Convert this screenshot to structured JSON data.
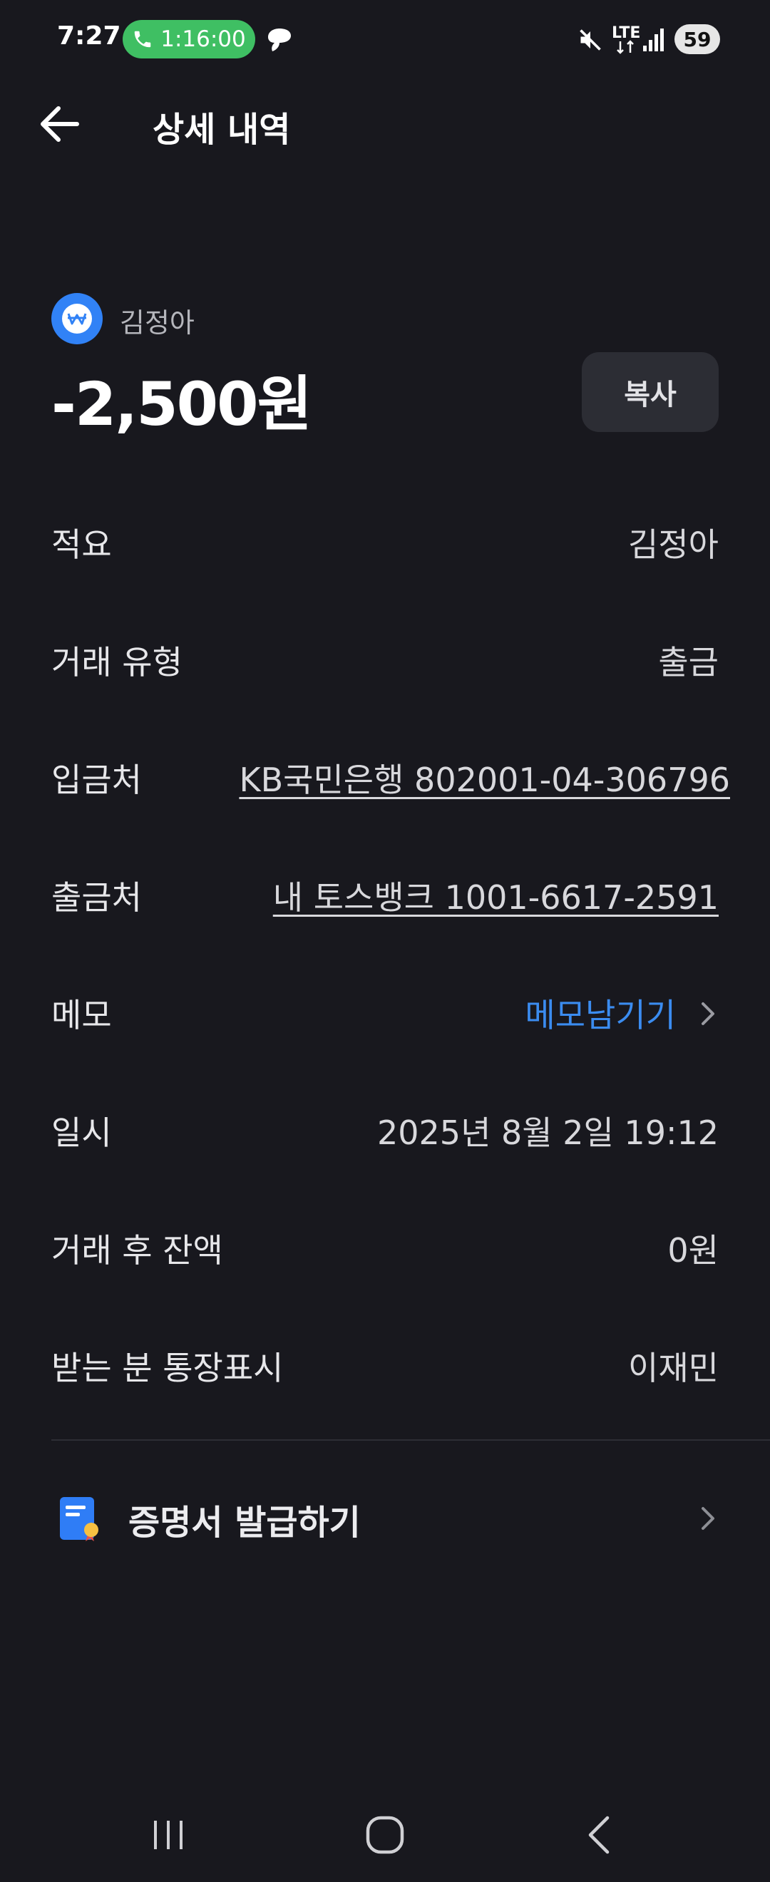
{
  "status_bar": {
    "time": "7:27",
    "call_timer": "1:16:00",
    "battery": "59",
    "network": "LTE"
  },
  "header": {
    "title": "상세 내역"
  },
  "transaction": {
    "counterparty": "김정아",
    "amount": "-2,500원",
    "copy_label": "복사"
  },
  "details": [
    {
      "label": "적요",
      "value": "김정아"
    },
    {
      "label": "거래 유형",
      "value": "출금"
    },
    {
      "label": "입금처",
      "value": "KB국민은행 802001-04-306796"
    },
    {
      "label": "출금처",
      "value": "내 토스뱅크 1001-6617-2591"
    },
    {
      "label": "메모",
      "value": "메모남기기"
    },
    {
      "label": "일시",
      "value": "2025년 8월 2일 19:12"
    },
    {
      "label": "거래 후 잔액",
      "value": "0원"
    },
    {
      "label": "받는 분 통장표시",
      "value": "이재민"
    }
  ],
  "certificate": {
    "label": "증명서 발급하기"
  },
  "colors": {
    "background": "#18181e",
    "accent_blue": "#3b8cf0",
    "call_green": "#3fbf63"
  }
}
